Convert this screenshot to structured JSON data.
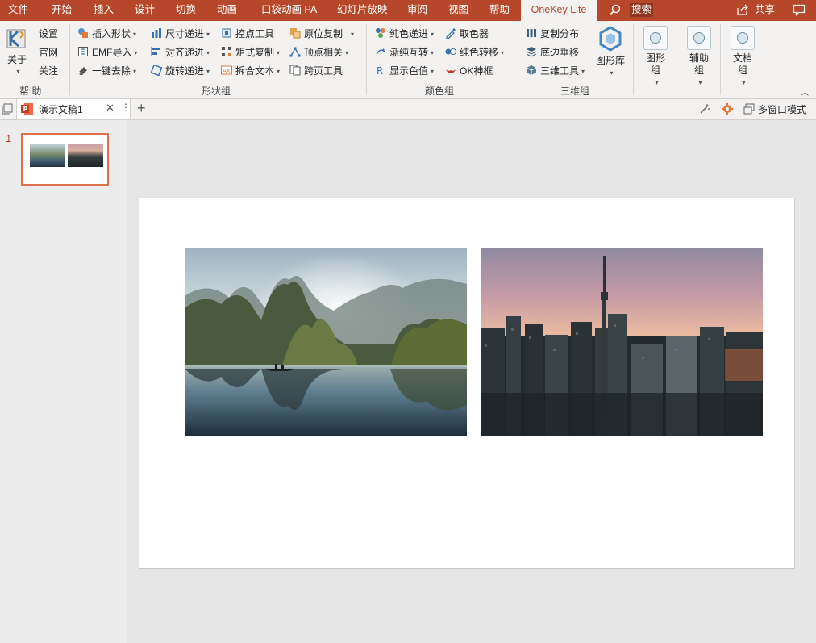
{
  "menubar": {
    "tabs": [
      "文件",
      "开始",
      "插入",
      "设计",
      "切换",
      "动画",
      "口袋动画 PA",
      "幻灯片放映",
      "审阅",
      "视图",
      "帮助",
      "OneKey Lite"
    ],
    "active_tab": "OneKey Lite",
    "search_label": "搜索",
    "share_label": "共享"
  },
  "ribbon": {
    "help_group": {
      "about_label": "关于",
      "settings": "设置",
      "website": "官网",
      "follow": "关注",
      "label": "帮 助"
    },
    "shape_group": {
      "col1": [
        "插入形状",
        "EMF导入",
        "一键去除"
      ],
      "col2": [
        "尺寸递进",
        "对齐递进",
        "旋转递进"
      ],
      "col3": [
        "控点工具",
        "矩式复制",
        "拆合文本"
      ],
      "col4": [
        "原位复制",
        "顶点相关",
        "跨页工具"
      ],
      "label": "形状组"
    },
    "color_group": {
      "col1": [
        "纯色递进",
        "渐纯互转",
        "显示色值"
      ],
      "col2": [
        "取色器",
        "纯色转移",
        "OK神框"
      ],
      "label": "颜色组"
    },
    "3d_group": {
      "items": [
        "复制分布",
        "底边垂移",
        "三维工具"
      ],
      "label": "三维组"
    },
    "big_buttons": {
      "shape_lib": "图形库",
      "shape_group_btn": "图形组",
      "aux_group_btn": "辅助组",
      "doc_group_btn": "文档组"
    }
  },
  "tabbar": {
    "doc_title": "演示文稿1",
    "multi_window": "多窗口模式"
  },
  "slides": {
    "current_number": "1"
  },
  "colors": {
    "accent": "#b7472a",
    "ribbon_bg": "#f3f2f1",
    "selected_thumb": "#e07050"
  }
}
